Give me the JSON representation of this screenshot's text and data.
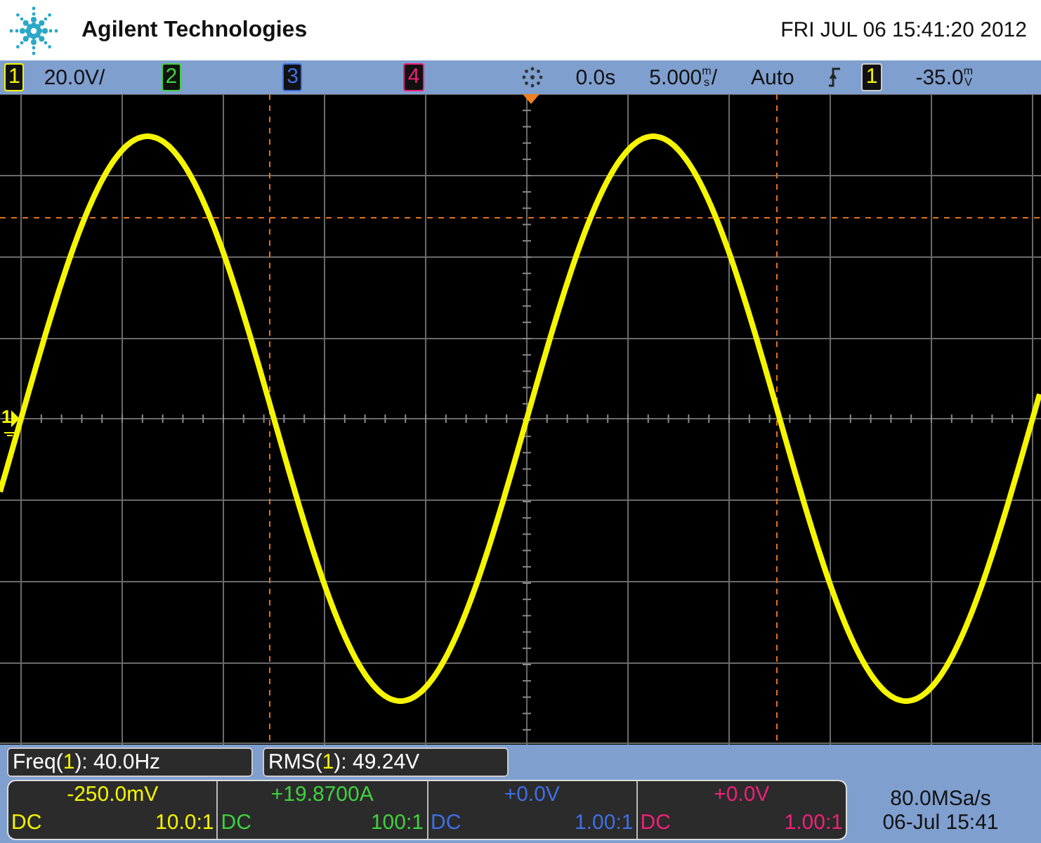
{
  "header": {
    "brand": "Agilent Technologies",
    "datetime": "FRI JUL 06 15:41:20 2012"
  },
  "top_bar": {
    "channels": [
      {
        "number": "1",
        "color": "#f5f500",
        "scale": "20.0V/"
      },
      {
        "number": "2",
        "color": "#3fd23f"
      },
      {
        "number": "3",
        "color": "#3f6fe8"
      },
      {
        "number": "4",
        "color": "#f0207a"
      }
    ],
    "delay": "0.0s",
    "time_scale": "5.000",
    "time_unit_prefix": "m",
    "time_unit": "s",
    "time_suffix": "/",
    "mode": "Auto",
    "trigger_source": "1",
    "trigger_level": "-35.0",
    "trigger_unit_prefix": "m",
    "trigger_unit": "V"
  },
  "trace_marker": {
    "number": "1",
    "color": "#f5f500"
  },
  "measurements": [
    {
      "before": "Freq(",
      "source": "1",
      "after": "): 40.0Hz",
      "color": "#f5f500"
    },
    {
      "before": "RMS(",
      "source": "1",
      "after": "): 49.24V",
      "color": "#f5f500"
    }
  ],
  "channel_panel": [
    {
      "offset": "-250.0mV",
      "coupling": "DC",
      "probe": "10.0:1",
      "color": "#f5f500"
    },
    {
      "offset": "+19.8700A",
      "coupling": "DC",
      "probe": "100:1",
      "color": "#3fd23f"
    },
    {
      "offset": "+0.0V",
      "coupling": "DC",
      "probe": "1.00:1",
      "color": "#3f6fe8"
    },
    {
      "offset": "+0.0V",
      "coupling": "DC",
      "probe": "1.00:1",
      "color": "#f0207a"
    }
  ],
  "sample_rate": "80.0MSa/s",
  "acq_date": "06-Jul 15:41"
}
